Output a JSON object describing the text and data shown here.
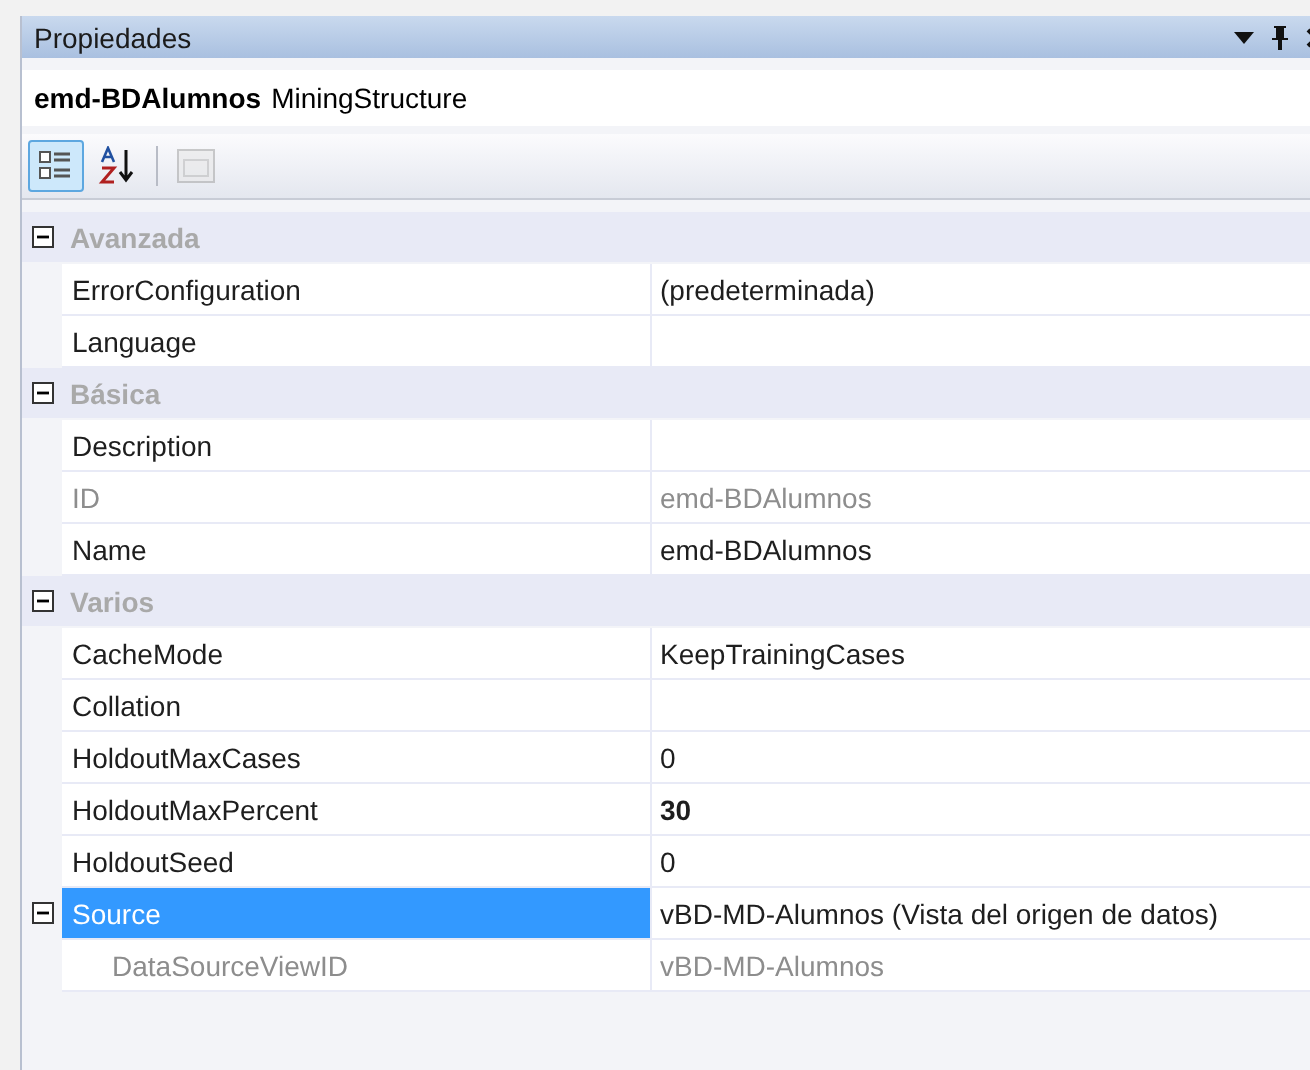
{
  "window": {
    "title": "Propiedades"
  },
  "object": {
    "name": "emd-BDAlumnos",
    "type": "MiningStructure"
  },
  "toolbar": [
    {
      "kind": "categorized",
      "selected": true,
      "disabled": false
    },
    {
      "kind": "alphabetical",
      "selected": false,
      "disabled": false
    },
    {
      "kind": "pages",
      "selected": false,
      "disabled": true
    }
  ],
  "categories": [
    {
      "label": "Avanzada",
      "expanded": true,
      "properties": [
        {
          "name": "ErrorConfiguration",
          "value": "(predeterminada)",
          "disabled": false,
          "bold": false,
          "selected": false
        },
        {
          "name": "Language",
          "disabled": false,
          "bold": false,
          "selected": false
        }
      ]
    },
    {
      "label": "Básica",
      "expanded": true,
      "properties": [
        {
          "name": "Description",
          "disabled": false,
          "bold": false,
          "selected": false
        },
        {
          "name": "ID",
          "value": "emd-BDAlumnos",
          "disabled": true,
          "bold": false,
          "selected": false
        },
        {
          "name": "Name",
          "value": "emd-BDAlumnos",
          "disabled": false,
          "bold": false,
          "selected": false
        }
      ]
    },
    {
      "label": "Varios",
      "expanded": true,
      "properties": [
        {
          "name": "CacheMode",
          "value": "KeepTrainingCases",
          "disabled": false,
          "bold": false,
          "selected": false
        },
        {
          "name": "Collation",
          "disabled": false,
          "bold": false,
          "selected": false
        },
        {
          "name": "HoldoutMaxCases",
          "value": "0",
          "disabled": false,
          "bold": false,
          "selected": false
        },
        {
          "name": "HoldoutMaxPercent",
          "value": "30",
          "disabled": false,
          "bold": true,
          "selected": false
        },
        {
          "name": "HoldoutSeed",
          "value": "0",
          "disabled": false,
          "bold": false,
          "selected": false
        },
        {
          "name": "Source",
          "value": "vBD-MD-Alumnos (Vista del origen de datos)",
          "disabled": false,
          "bold": false,
          "selected": true,
          "expanded": true,
          "children": [
            {
              "name": "DataSourceViewID",
              "value": "vBD-MD-Alumnos",
              "disabled": true,
              "bold": false,
              "selected": false
            }
          ]
        }
      ]
    }
  ]
}
